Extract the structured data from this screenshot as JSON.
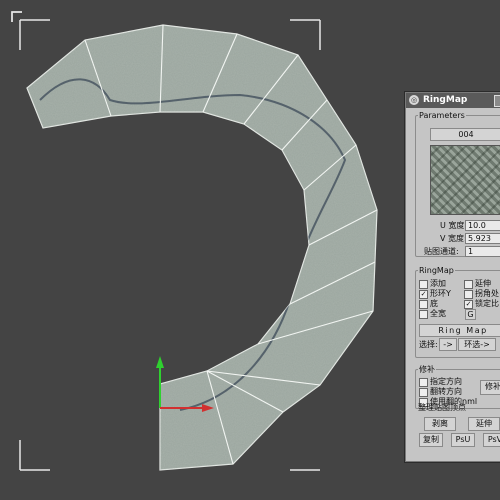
{
  "colors": {
    "viewport_bg": "#444444",
    "panel_bg": "#c5c5c5",
    "axis_y": "#2fd12f",
    "axis_x": "#d23030",
    "ring_texture": "#9aa59e"
  },
  "panel": {
    "title": "RingMap",
    "title_icon": "ringmap-icon",
    "parameters": {
      "label": "Parameters",
      "material_button": "004",
      "u_label": "U 宽度:",
      "u_value": "10.0",
      "v_label": "V 宽度:",
      "v_value": "5.923",
      "channel_label": "贴图通道:",
      "channel_value": "1"
    },
    "ringmap": {
      "label": "RingMap",
      "options": [
        {
          "label": "添加",
          "checked": false
        },
        {
          "label": "延伸",
          "checked": false
        },
        {
          "label": "形环Y",
          "checked": true
        },
        {
          "label": "拐角处",
          "checked": false
        },
        {
          "label": "底",
          "checked": false
        },
        {
          "label": "锁定比",
          "checked": true
        },
        {
          "label": "全宽",
          "checked": false
        },
        {
          "label": "G",
          "checked": false
        }
      ],
      "ringmap_button": "Ring Map",
      "select_label": "选择:",
      "select_arrow_button": "->",
      "select_ring_button": "环选->"
    },
    "correction": {
      "label": "修补",
      "options": [
        {
          "label": "指定方向",
          "checked": false
        },
        {
          "label": "翻转方向",
          "checked": false
        },
        {
          "label": "使用翻的nml",
          "checked": false
        }
      ],
      "fix_button": "修补"
    },
    "vertices": {
      "label": "整理贴图顶点",
      "peel_button": "剥离",
      "extend_button": "延伸",
      "copy_button": "复制",
      "psu_button": "PsU",
      "psv_button": "PsV"
    }
  }
}
